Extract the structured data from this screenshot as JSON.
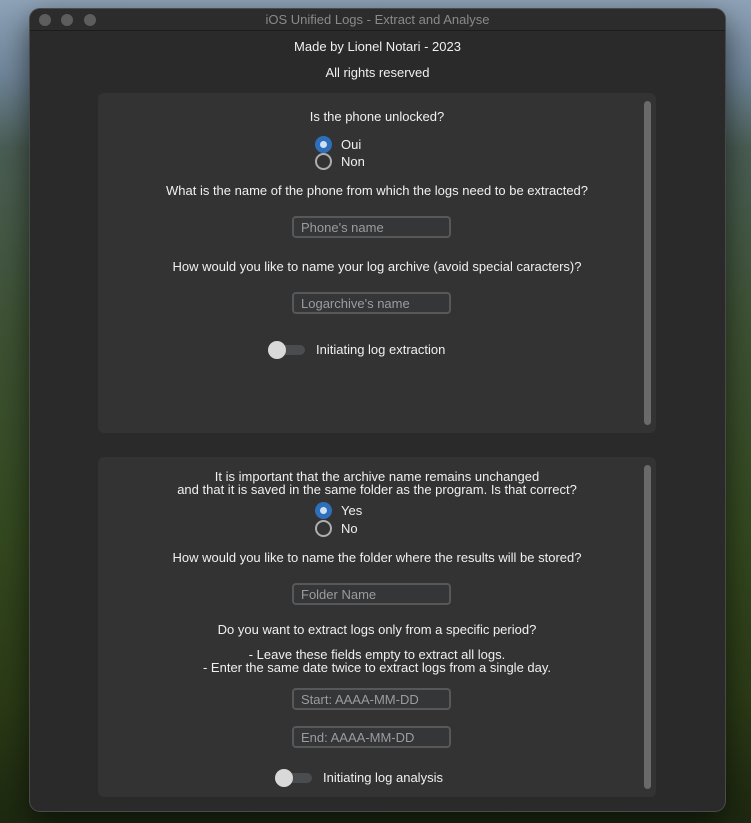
{
  "window": {
    "title": "iOS Unified Logs - Extract and Analyse"
  },
  "header": {
    "credit": "Made by Lionel Notari - 2023",
    "rights": "All rights reserved"
  },
  "extraction": {
    "unlock_question": "Is the phone unlocked?",
    "unlock_options": [
      {
        "label": "Oui",
        "selected": true
      },
      {
        "label": "Non",
        "selected": false
      }
    ],
    "phone_question": "What is the name of the phone from which the logs need to be extracted?",
    "phone_placeholder": "Phone's name",
    "archive_question": "How would you like to name your log archive (avoid special caracters)?",
    "archive_placeholder": "Logarchive's name",
    "toggle_label": "Initiating log extraction",
    "toggle_on": false
  },
  "analysis": {
    "archive_check_line1": "It is important that the archive name remains unchanged",
    "archive_check_line2": "and that it is saved in the same folder as the program. Is that correct?",
    "archive_options": [
      {
        "label": "Yes",
        "selected": true
      },
      {
        "label": "No",
        "selected": false
      }
    ],
    "folder_question": "How would you like to name the folder where the results will be stored?",
    "folder_placeholder": "Folder Name",
    "period_question": "Do you want to extract logs only from a specific period?",
    "hint_empty": "- Leave these fields empty to extract all logs.",
    "hint_same_date": "- Enter the same date twice to extract logs from a single day.",
    "start_placeholder": "Start: AAAA-MM-DD",
    "end_placeholder": "End: AAAA-MM-DD",
    "toggle_label": "Initiating log analysis",
    "toggle_on": false
  },
  "colors": {
    "accent": "#2e6fbc",
    "window_bg": "#2a2a2a",
    "panel_bg": "#333333"
  }
}
